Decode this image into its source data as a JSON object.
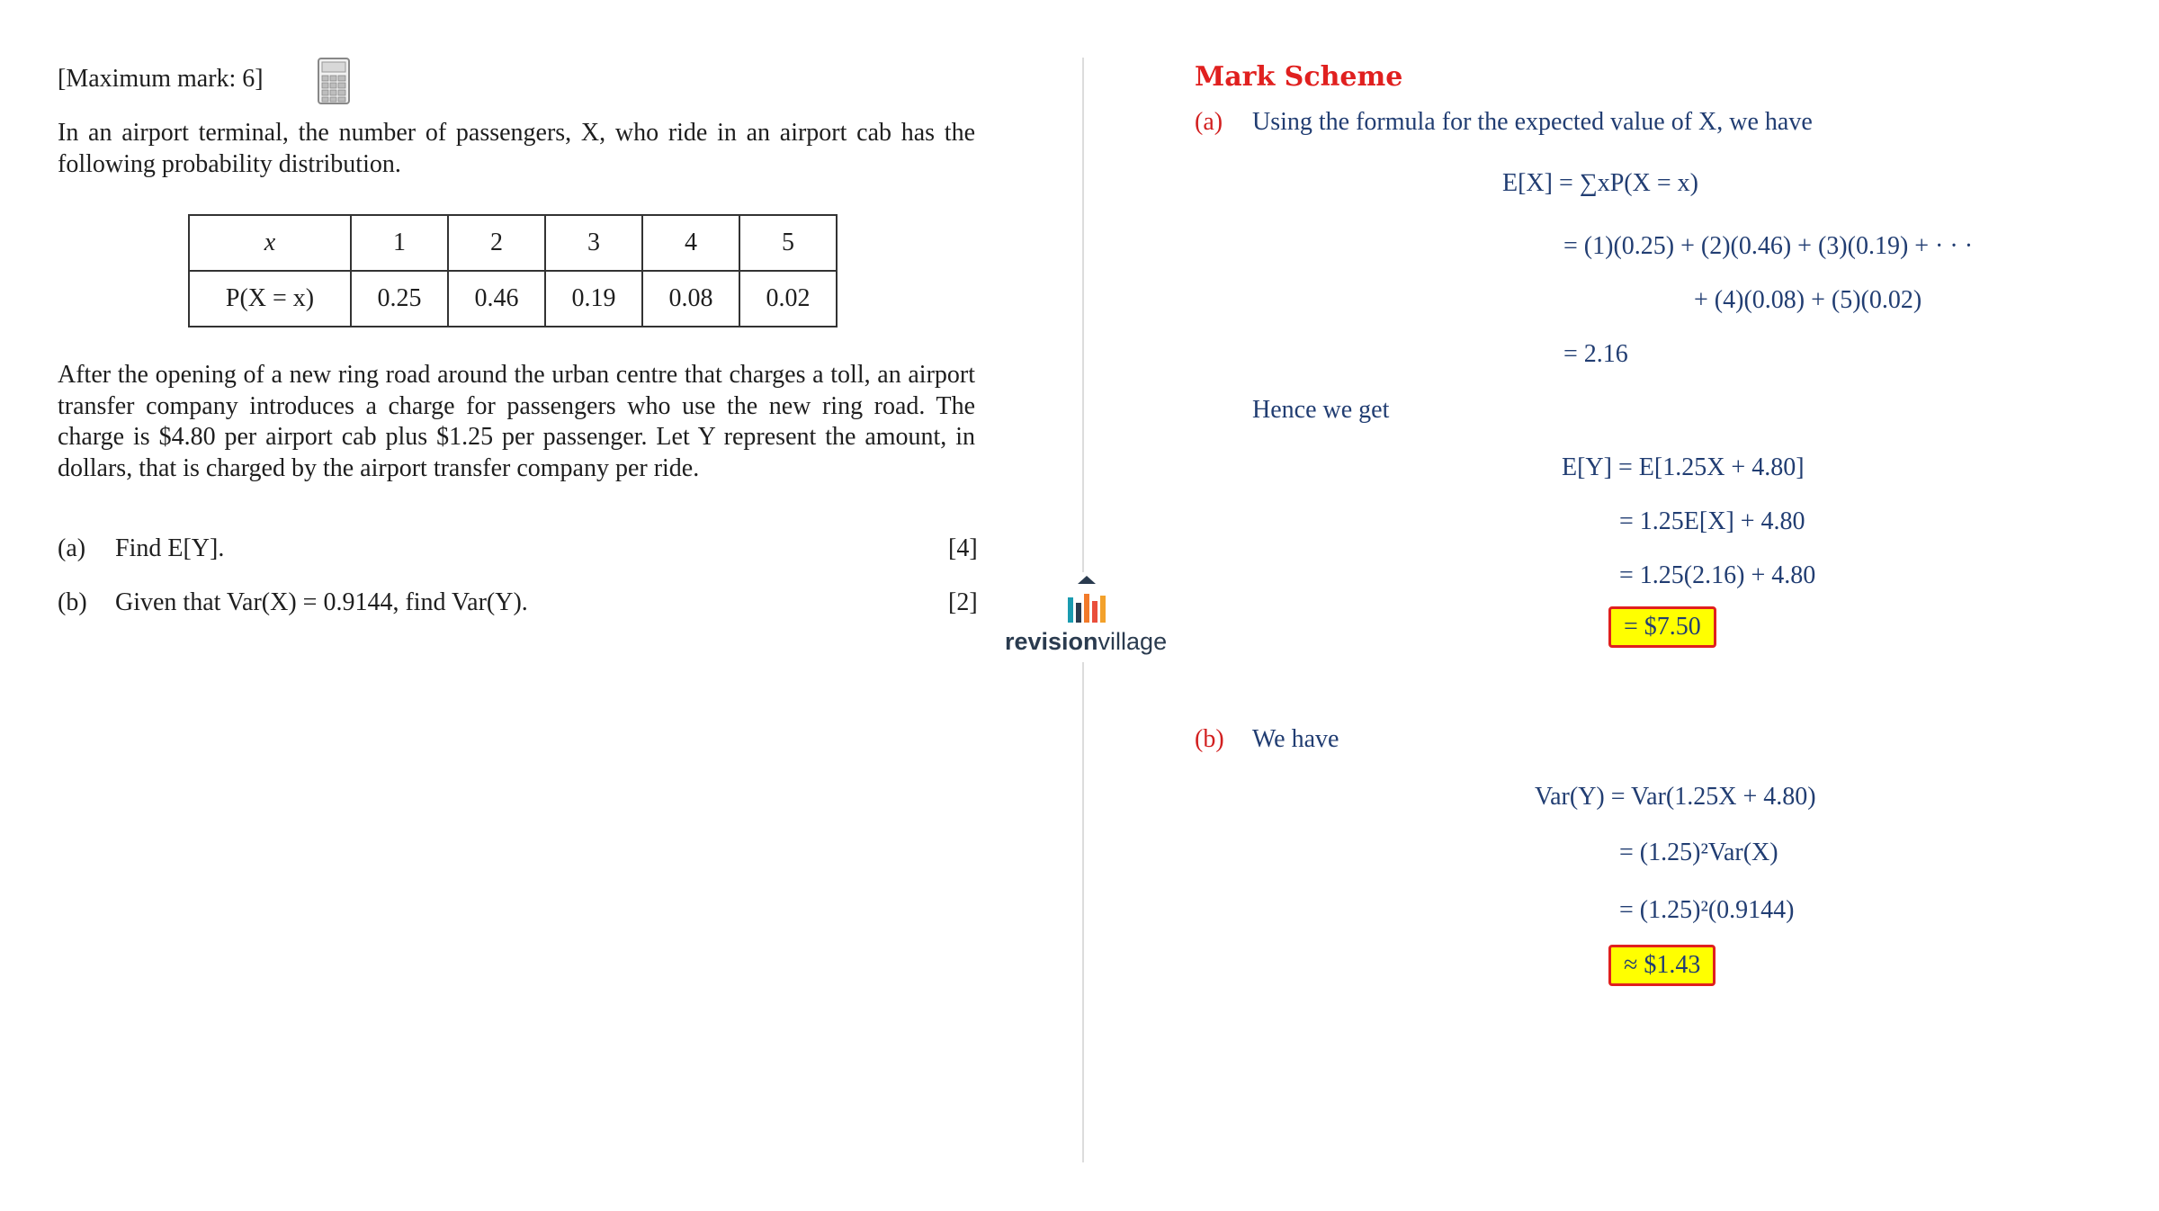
{
  "question": {
    "max_mark": "[Maximum mark: 6]",
    "calculator_icon": "calculator-icon",
    "intro": "In an airport terminal, the number of passengers, X, who ride in an airport cab has the following probability distribution.",
    "table": {
      "header": [
        "x",
        "1",
        "2",
        "3",
        "4",
        "5"
      ],
      "row": [
        "P(X = x)",
        "0.25",
        "0.46",
        "0.19",
        "0.08",
        "0.02"
      ]
    },
    "body": "After the opening of a new ring road around the urban centre that charges a toll, an airport transfer company introduces a charge for passengers who use the new ring road. The charge is $4.80 per airport cab plus $1.25 per passenger. Let Y represent the amount, in dollars, that is charged by the airport transfer company per ride.",
    "parts": [
      {
        "label": "(a)",
        "text": "Find E[Y].",
        "marks": "[4]"
      },
      {
        "label": "(b)",
        "text": "Given that Var(X) = 0.9144, find Var(Y).",
        "marks": "[2]"
      }
    ]
  },
  "logo": {
    "text_bold": "revision",
    "text_light": "village"
  },
  "markscheme": {
    "title": "Mark Scheme",
    "a": {
      "label": "(a)",
      "intro": "Using the formula for the expected value of X, we have",
      "lines": [
        "E[X] = ∑xP(X = x)",
        "= (1)(0.25) + (2)(0.46) + (3)(0.19) + · · ·",
        "+ (4)(0.08) + (5)(0.02)",
        "= 2.16"
      ],
      "hence": "Hence we get",
      "lines2": [
        "E[Y] = E[1.25X + 4.80]",
        "= 1.25E[X] + 4.80",
        "= 1.25(2.16) + 4.80"
      ],
      "answer": "= $7.50"
    },
    "b": {
      "label": "(b)",
      "intro": "We have",
      "lines": [
        "Var(Y) = Var(1.25X + 4.80)",
        "= (1.25)²Var(X)",
        "= (1.25)²(0.9144)"
      ],
      "answer": "≈ $1.43"
    }
  }
}
